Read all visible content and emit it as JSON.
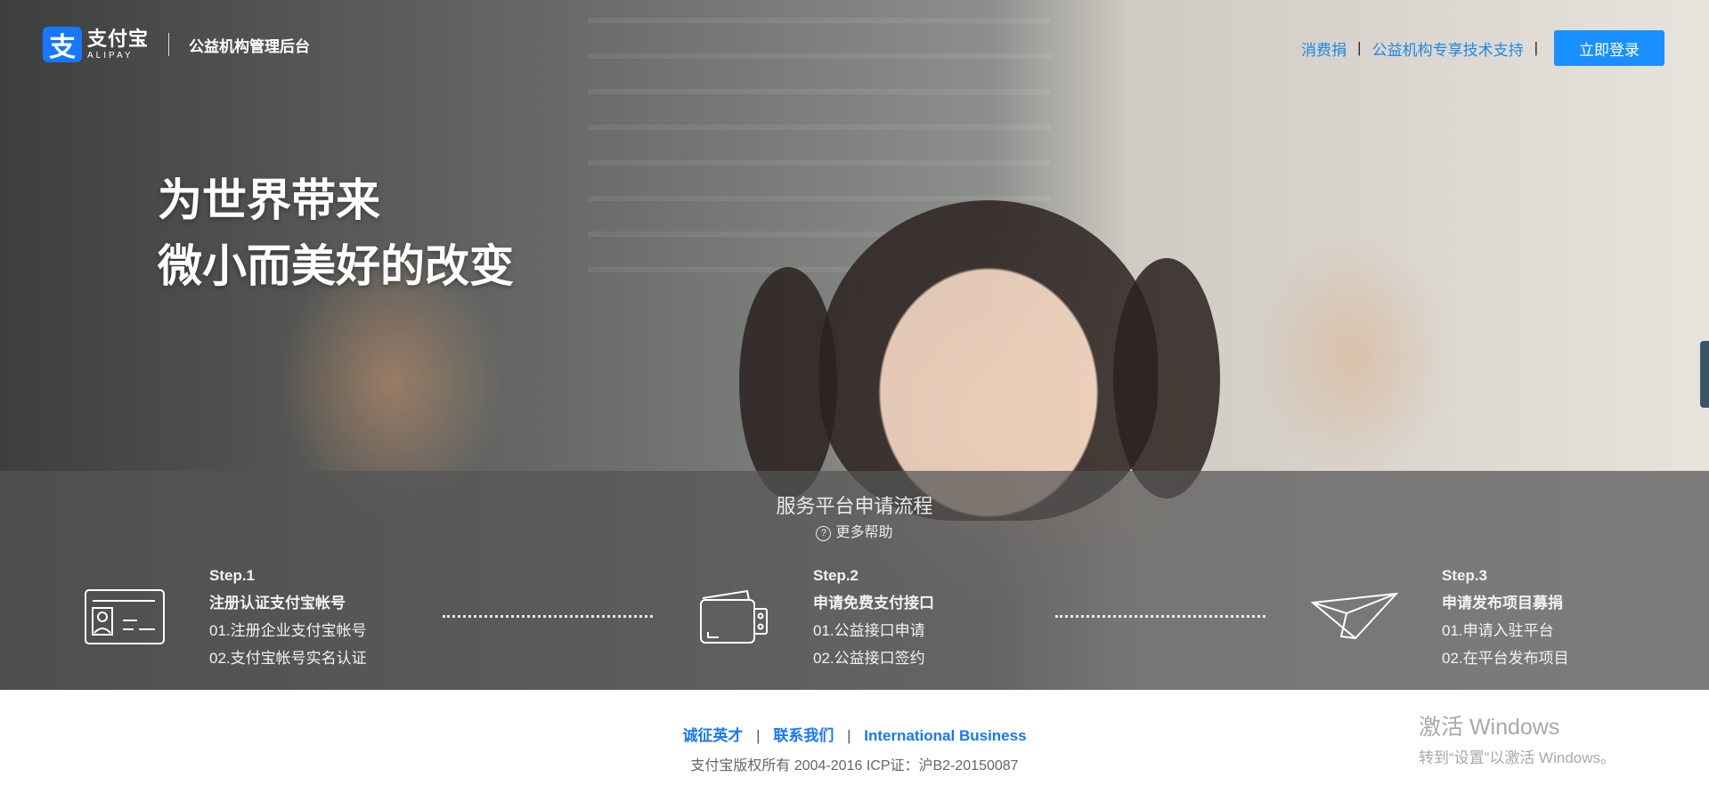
{
  "header": {
    "logo_mark": "支",
    "logo_cn": "支付宝",
    "logo_en": "ALIPAY",
    "subtitle": "公益机构管理后台",
    "nav": [
      {
        "label": "消费捐"
      },
      {
        "label": "公益机构专享技术支持"
      }
    ],
    "separator": "|",
    "login_label": "立即登录"
  },
  "hero": {
    "slogan_line1": "为世界带来",
    "slogan_line2": "微小而美好的改变"
  },
  "process": {
    "title": "服务平台申请流程",
    "help_icon": "?",
    "help_label": "更多帮助",
    "steps": [
      {
        "label": "Step.1",
        "title": "注册认证支付宝帐号",
        "item1": "01.注册企业支付宝帐号",
        "item2": "02.支付宝帐号实名认证",
        "icon": "id-card-icon"
      },
      {
        "label": "Step.2",
        "title": "申请免费支付接口",
        "item1": "01.公益接口申请",
        "item2": "02.公益接口签约",
        "icon": "wallet-icon"
      },
      {
        "label": "Step.3",
        "title": "申请发布项目募捐",
        "item1": "01.申请入驻平台",
        "item2": "02.在平台发布项目",
        "icon": "paper-plane-icon"
      }
    ]
  },
  "footer": {
    "links": [
      {
        "label": "诚征英才"
      },
      {
        "label": "联系我们"
      },
      {
        "label": "International Business"
      }
    ],
    "separator": "|",
    "copyright": "支付宝版权所有 2004-2016 ICP证：沪B2-20150087"
  },
  "watermark": {
    "line1": "激活 Windows",
    "line2": "转到“设置”以激活 Windows。"
  },
  "colors": {
    "accent": "#1890ff",
    "link": "#1e88e5",
    "band": "#555555"
  }
}
